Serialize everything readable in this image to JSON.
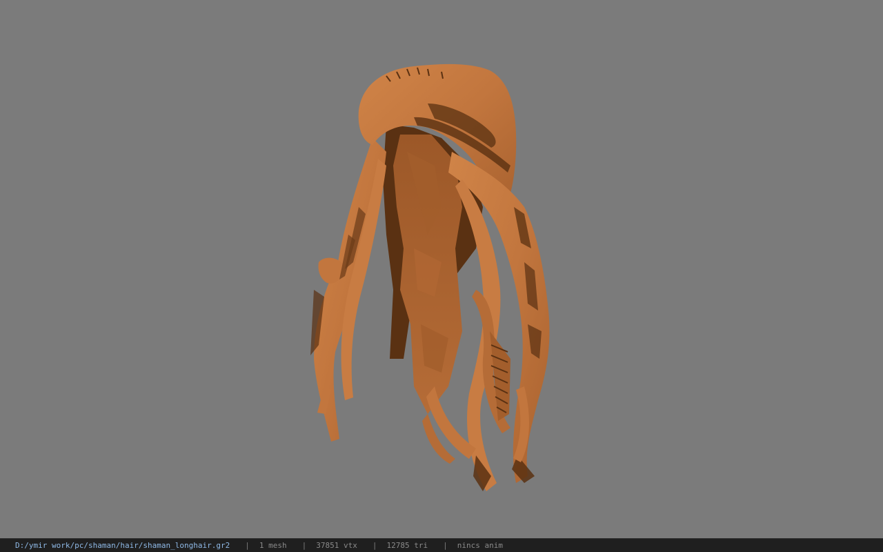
{
  "viewport": {
    "background": "#7b7b7b",
    "mesh_color": "#c2763e",
    "mesh_shadow": "#5a3112",
    "model": "hair-mesh"
  },
  "status": {
    "path": "D:/ymir work/pc/shaman/hair/shaman_longhair.gr2",
    "sep": "|",
    "mesh": "1 mesh",
    "vtx": "37851 vtx",
    "tri": "12785 tri",
    "anim": "nincs anim"
  }
}
